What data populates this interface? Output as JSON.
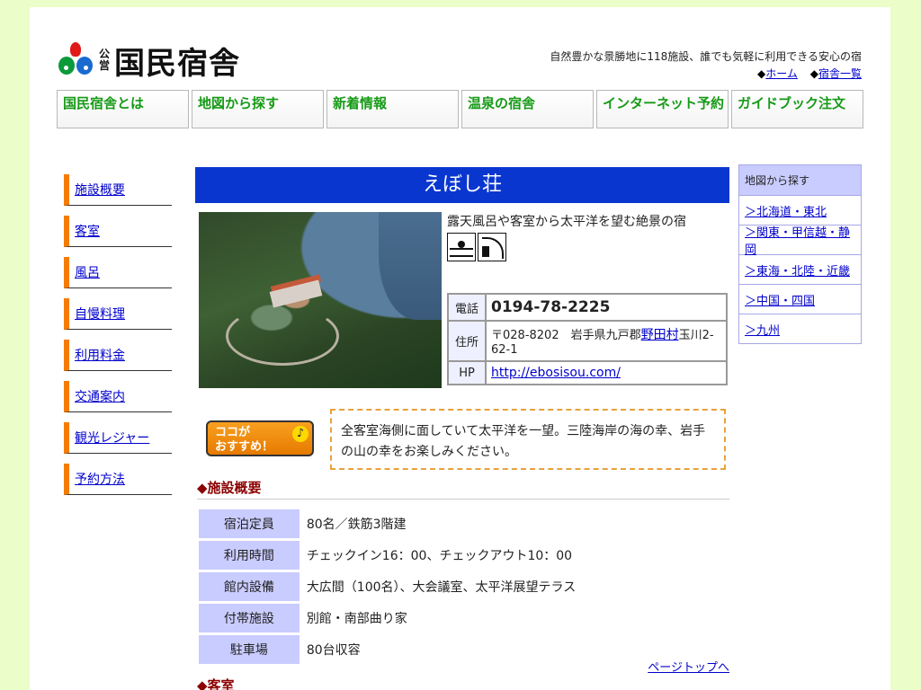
{
  "header": {
    "logo_small": "公営",
    "logo_text": "国民宿舎",
    "tagline": "自然豊かな景勝地に118施設、誰でも気軽に利用できる安心の宿",
    "links": [
      {
        "prefix": "◆",
        "label": "ホーム"
      },
      {
        "prefix": "◆",
        "label": "宿舎一覧"
      }
    ]
  },
  "nav": [
    {
      "label": "国民宿舎とは"
    },
    {
      "label": "地図から探す"
    },
    {
      "label": "新着情報"
    },
    {
      "label": "温泉の宿舎"
    },
    {
      "label": "インターネット予約"
    },
    {
      "label": "ガイドブック注文"
    }
  ],
  "sidebar": {
    "items": [
      {
        "label": "施設概要"
      },
      {
        "label": "客室"
      },
      {
        "label": "風呂"
      },
      {
        "label": "自慢料理"
      },
      {
        "label": "利用料金"
      },
      {
        "label": "交通案内"
      },
      {
        "label": "観光レジャー"
      },
      {
        "label": "予約方法"
      }
    ]
  },
  "main": {
    "title": "えぼし荘",
    "catch": "露天風呂や客室から太平洋を望む絶景の宿",
    "icons": [
      "outdoor-bath-icon",
      "fishing-icon"
    ],
    "info": {
      "phone_label": "電話",
      "phone": "0194-78-2225",
      "address_label": "住所",
      "address_pre": "〒028-8202　岩手県九戸郡",
      "address_link": "野田村",
      "address_post": "玉川2-62-1",
      "hp_label": "HP",
      "hp": "http://ebosisou.com/"
    },
    "recommend": {
      "badge_line1": "ココが",
      "badge_line2": "おすすめ！",
      "note": "♪",
      "text": "全客室海側に面していて太平洋を一望。三陸海岸の海の幸、岩手の山の幸をお楽しみください。"
    },
    "section1": "◆施設概要",
    "specs": [
      {
        "key": "宿泊定員",
        "value": "80名／鉄筋3階建"
      },
      {
        "key": "利用時間",
        "value": "チェックイン16：00、チェックアウト10：00"
      },
      {
        "key": "館内設備",
        "value": "大広間（100名）、大会議室、太平洋展望テラス"
      },
      {
        "key": "付帯施設",
        "value": "別館・南部曲り家"
      },
      {
        "key": "駐車場",
        "value": "80台収容"
      }
    ],
    "pagetop": "ページトップへ",
    "section2": "◆客室"
  },
  "right": {
    "head": "地図から探す",
    "items": [
      {
        "label": "＞北海道・東北"
      },
      {
        "label": "＞関東・甲信越・静岡"
      },
      {
        "label": "＞東海・北陸・近畿"
      },
      {
        "label": "＞中国・四国"
      },
      {
        "label": "＞九州"
      }
    ]
  }
}
